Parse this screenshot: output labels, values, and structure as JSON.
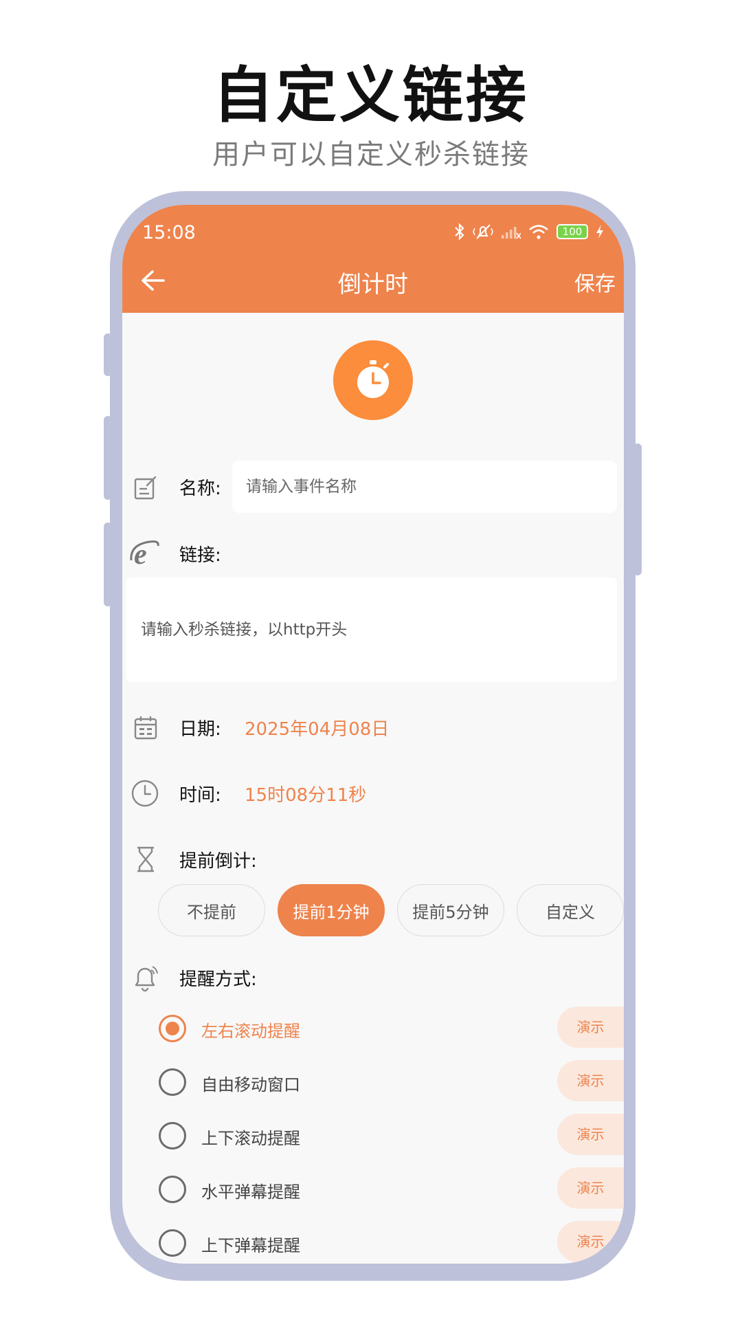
{
  "promo": {
    "headline": "自定义链接",
    "subhead": "用户可以自定义秒杀链接"
  },
  "status_bar": {
    "time": "15:08",
    "battery": "100"
  },
  "app_bar": {
    "title": "倒计时",
    "save_label": "保存"
  },
  "form": {
    "name": {
      "label": "名称:",
      "placeholder": "请输入事件名称"
    },
    "link": {
      "label": "链接:",
      "placeholder": "请输入秒杀链接，以http开头"
    },
    "date": {
      "label": "日期:",
      "value": "2025年04月08日"
    },
    "time": {
      "label": "时间:",
      "value": "15时08分11秒"
    },
    "advance": {
      "label": "提前倒计:",
      "options": [
        "不提前",
        "提前1分钟",
        "提前5分钟",
        "自定义"
      ],
      "selected": "提前1分钟"
    },
    "reminder": {
      "label": "提醒方式:",
      "demo_label": "演示",
      "options": [
        {
          "label": "左右滚动提醒",
          "checked": true
        },
        {
          "label": "自由移动窗口",
          "checked": false
        },
        {
          "label": "上下滚动提醒",
          "checked": false
        },
        {
          "label": "水平弹幕提醒",
          "checked": false
        },
        {
          "label": "上下弹幕提醒",
          "checked": false
        }
      ]
    }
  },
  "colors": {
    "accent": "#ee834c",
    "badge": "#fb8d3c",
    "frame": "#bdc1d9",
    "demo_bg": "#fbe7dc"
  }
}
